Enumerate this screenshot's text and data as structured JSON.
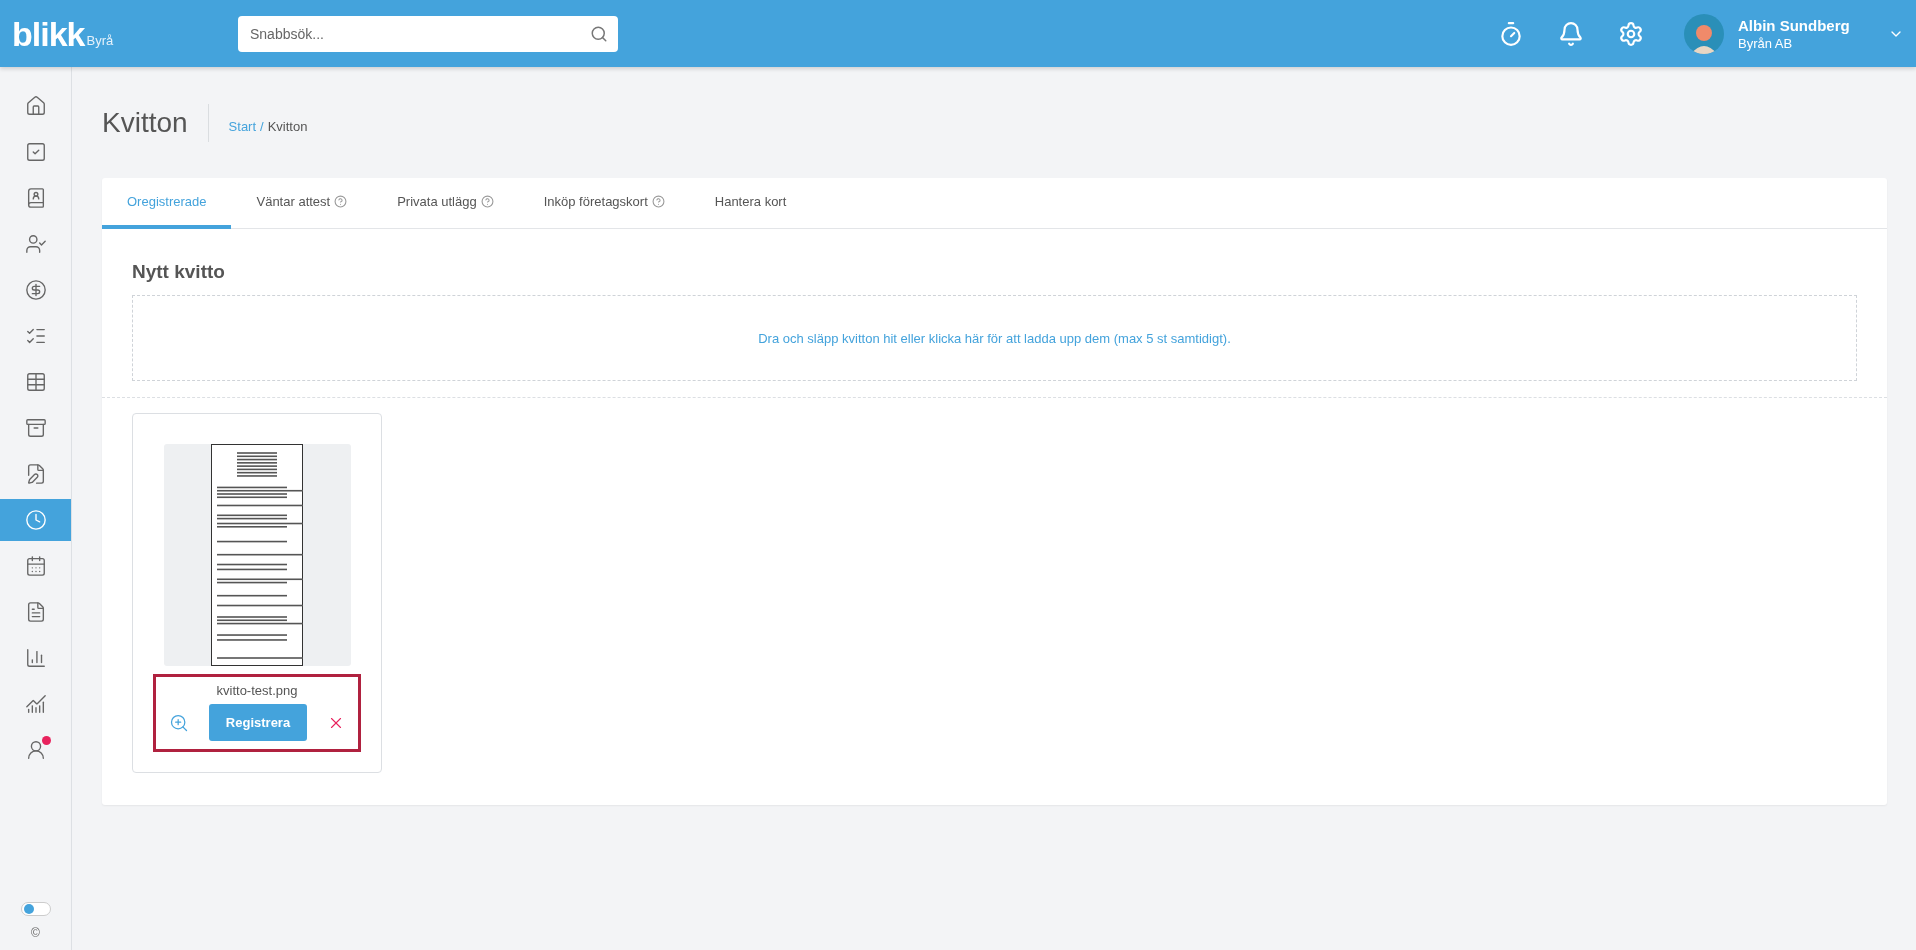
{
  "header": {
    "logo": "blikk",
    "logo_suffix": "Byrå",
    "search": {
      "placeholder": "Snabbsök..."
    },
    "user": {
      "name": "Albin Sundberg",
      "company": "Byrån AB"
    }
  },
  "sidebar": {
    "items": [
      {
        "selected": false,
        "badge": false
      },
      {
        "selected": false,
        "badge": false
      },
      {
        "selected": false,
        "badge": false
      },
      {
        "selected": false,
        "badge": false
      },
      {
        "selected": false,
        "badge": false
      },
      {
        "selected": false,
        "badge": false
      },
      {
        "selected": false,
        "badge": false
      },
      {
        "selected": false,
        "badge": false
      },
      {
        "selected": false,
        "badge": false
      },
      {
        "selected": true,
        "badge": false
      },
      {
        "selected": false,
        "badge": false
      },
      {
        "selected": false,
        "badge": false
      },
      {
        "selected": false,
        "badge": false
      },
      {
        "selected": false,
        "badge": false
      },
      {
        "selected": false,
        "badge": true
      }
    ],
    "toggle": {
      "on": false
    },
    "copyright": "©"
  },
  "page": {
    "title": "Kvitton",
    "breadcrumb_separator": "/",
    "breadcrumb": [
      {
        "label": "Start",
        "link": true
      },
      {
        "label": "Kvitton",
        "link": false
      }
    ]
  },
  "tabs": [
    {
      "label": "Oregistrerade",
      "selected": true,
      "help": false
    },
    {
      "label": "Väntar attest",
      "selected": false,
      "help": true
    },
    {
      "label": "Privata utlägg",
      "selected": false,
      "help": true
    },
    {
      "label": "Inköp företagskort",
      "selected": false,
      "help": true
    },
    {
      "label": "Hantera kort",
      "selected": false,
      "help": false
    }
  ],
  "upload": {
    "heading": "Nytt kvitto",
    "dropzone": "Dra och släpp kvitton hit eller klicka här för att ladda upp dem (max 5 st samtidigt)."
  },
  "files": [
    {
      "filename": "kvitto-test.png",
      "button": "Registrera",
      "highlighted": true
    }
  ]
}
